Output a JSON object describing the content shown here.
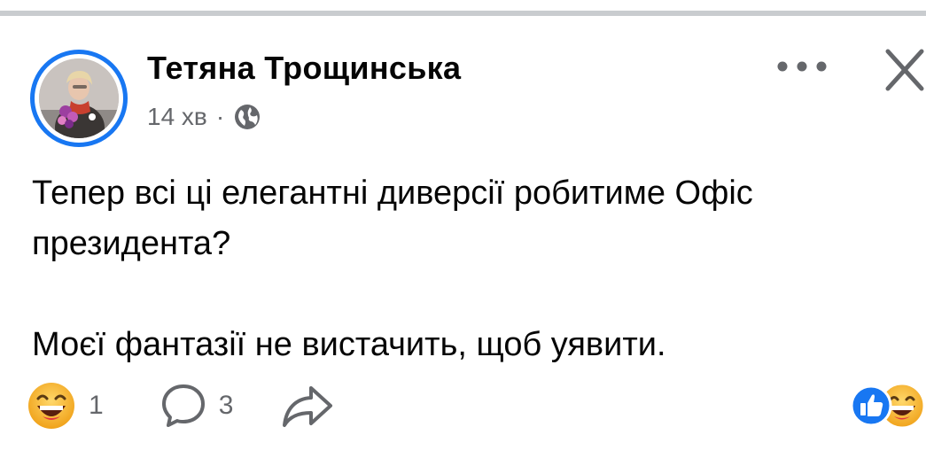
{
  "post": {
    "author": "Тетяна Трощинська",
    "time": "14 хв",
    "separator": "·",
    "privacy_icon": "globe-icon",
    "more_icon": "more-dots-icon",
    "close_icon": "close-icon",
    "text_line1": "Тепер всі ці елегантні диверсії робитиме Офіс президента?",
    "text_line2": "Моєї фантазії не вистачить, щоб уявити."
  },
  "actions": {
    "reaction_icon": "laughing-emoji-icon",
    "reaction_count": "1",
    "comment_icon": "comment-bubble-icon",
    "comment_count": "3",
    "share_icon": "share-arrow-icon",
    "summary_icons": [
      "like-icon",
      "laughing-emoji-icon"
    ]
  },
  "colors": {
    "accent": "#1877f2",
    "secondary_text": "#65676b",
    "primary_text": "#050505",
    "emoji_yellow": "#f7b125"
  }
}
